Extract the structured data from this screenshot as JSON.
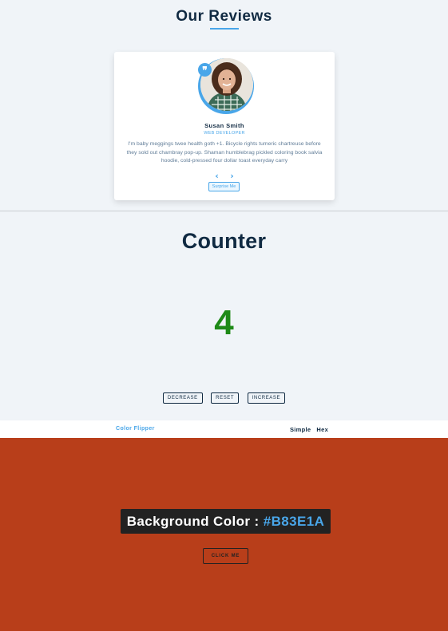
{
  "reviews": {
    "title": "Our Reviews",
    "quote_icon": "quote-icon",
    "author": "Susan Smith",
    "job": "WEB DEVELOPER",
    "text": "I'm baby meggings twee health goth +1. Bicycle rights tumeric chartreuse before they sold out chambray pop-up. Shaman humblebrag pickled coloring book salvia hoodie, cold-pressed four dollar toast everyday carry",
    "prev_label": "‹",
    "next_label": "›",
    "surprise_label": "Surprise Me"
  },
  "counter": {
    "title": "Counter",
    "value": "4",
    "decrease_label": "DECREASE",
    "reset_label": "RESET",
    "increase_label": "INCREASE"
  },
  "flipper": {
    "brand": "Color Flipper",
    "nav_links": [
      "Simple",
      "Hex"
    ],
    "label": "Background Color : ",
    "hex": "#B83E1A",
    "button_label": "CLICK ME"
  },
  "colors": {
    "accent": "#49a6e9",
    "counter_value": "#1e8a17",
    "flipper_background": "#B83E1A",
    "page_background": "#f0f4f8"
  }
}
